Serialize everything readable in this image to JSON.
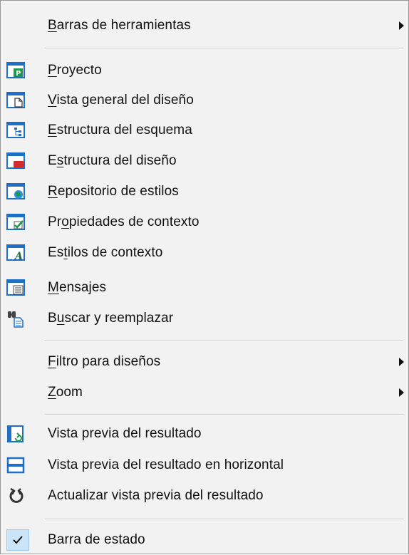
{
  "menu": {
    "items": [
      {
        "pre": "",
        "ul": "B",
        "post": "arras de herramientas",
        "icon": "none",
        "submenu": true
      },
      {
        "pre": "",
        "ul": "P",
        "post": "royecto",
        "icon": "project-window-icon"
      },
      {
        "pre": "",
        "ul": "V",
        "post": "ista general del diseño",
        "icon": "design-overview-icon"
      },
      {
        "pre": "",
        "ul": "E",
        "post": "structura del esquema",
        "icon": "schema-tree-icon"
      },
      {
        "pre": "E",
        "ul": "s",
        "post": "tructura del diseño",
        "icon": "design-tree-icon"
      },
      {
        "pre": "",
        "ul": "R",
        "post": "epositorio de estilos",
        "icon": "style-repository-icon"
      },
      {
        "pre": "Pr",
        "ul": "o",
        "post": "piedades de contexto",
        "icon": "properties-icon"
      },
      {
        "pre": "Es",
        "ul": "t",
        "post": "ilos de contexto",
        "icon": "styles-icon"
      },
      {
        "pre": "",
        "ul": "M",
        "post": "ensajes",
        "icon": "messages-icon"
      },
      {
        "pre": "B",
        "ul": "u",
        "post": "scar y reemplazar",
        "icon": "find-replace-icon"
      },
      {
        "pre": "",
        "ul": "F",
        "post": "iltro para diseños",
        "icon": "none",
        "submenu": true
      },
      {
        "pre": "",
        "ul": "Z",
        "post": "oom",
        "icon": "none",
        "submenu": true
      },
      {
        "pre": "",
        "ul": "",
        "post": "Vista previa del resultado",
        "icon": "output-preview-icon"
      },
      {
        "pre": "",
        "ul": "",
        "post": "Vista previa del resultado en horizontal",
        "icon": "horizontal-preview-icon"
      },
      {
        "pre": "",
        "ul": "",
        "post": "Actualizar vista previa del resultado",
        "icon": "refresh-preview-icon"
      },
      {
        "pre": "",
        "ul": "",
        "post": "Barra de estado",
        "icon": "checkmark-icon",
        "checked": true
      }
    ]
  },
  "colors": {
    "menu_bg": "#f2f2f2",
    "icon_blue": "#1e6fc6",
    "icon_green": "#1a9a4a",
    "icon_red": "#d42a2a",
    "check_bg": "#cce4f7"
  }
}
